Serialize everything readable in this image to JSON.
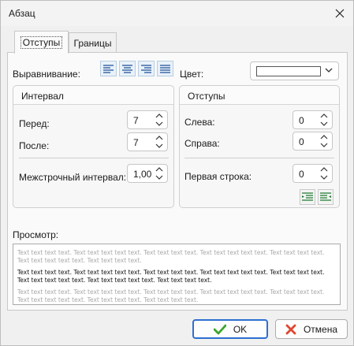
{
  "window": {
    "title": "Абзац"
  },
  "tabs": [
    {
      "label": "Отступы",
      "active": true
    },
    {
      "label": "Границы",
      "active": false
    }
  ],
  "alignment": {
    "label": "Выравнивание:",
    "buttons": [
      "align-left-icon",
      "align-center-icon",
      "align-right-icon",
      "align-justify-icon"
    ]
  },
  "color": {
    "label": "Цвет:",
    "value": "#ffffff"
  },
  "interval_group": {
    "title": "Интервал",
    "before_label": "Перед:",
    "before_value": "7",
    "after_label": "После:",
    "after_value": "7",
    "line_spacing_label": "Межстрочный интервал:",
    "line_spacing_value": "1,00"
  },
  "indent_group": {
    "title": "Отступы",
    "left_label": "Слева:",
    "left_value": "0",
    "right_label": "Справа:",
    "right_value": "0",
    "first_line_label": "Первая строка:",
    "first_line_value": "0"
  },
  "preview": {
    "label": "Просмотр:",
    "before_text": "Text text text text. Text text text text text. Text text text text. Text text text text text. Text text text text. Text text text text text. Text text text text.",
    "main_text": "Text text text text. Text text text text text. Text text text text. Text text text text text. Text text text text. Text text text text text. Text text text text text. Text text text text.",
    "after_text": "Text text text text. Text text text text text. Text text text text. Text text text text text. Text text text text. Text text text text text. Text text text text. Text text text text."
  },
  "buttons": {
    "ok": "OK",
    "cancel": "Отмена"
  },
  "colors": {
    "ok_check": "#3aa52c",
    "cancel_cross": "#e0452f",
    "accent": "#2e6fd1"
  }
}
